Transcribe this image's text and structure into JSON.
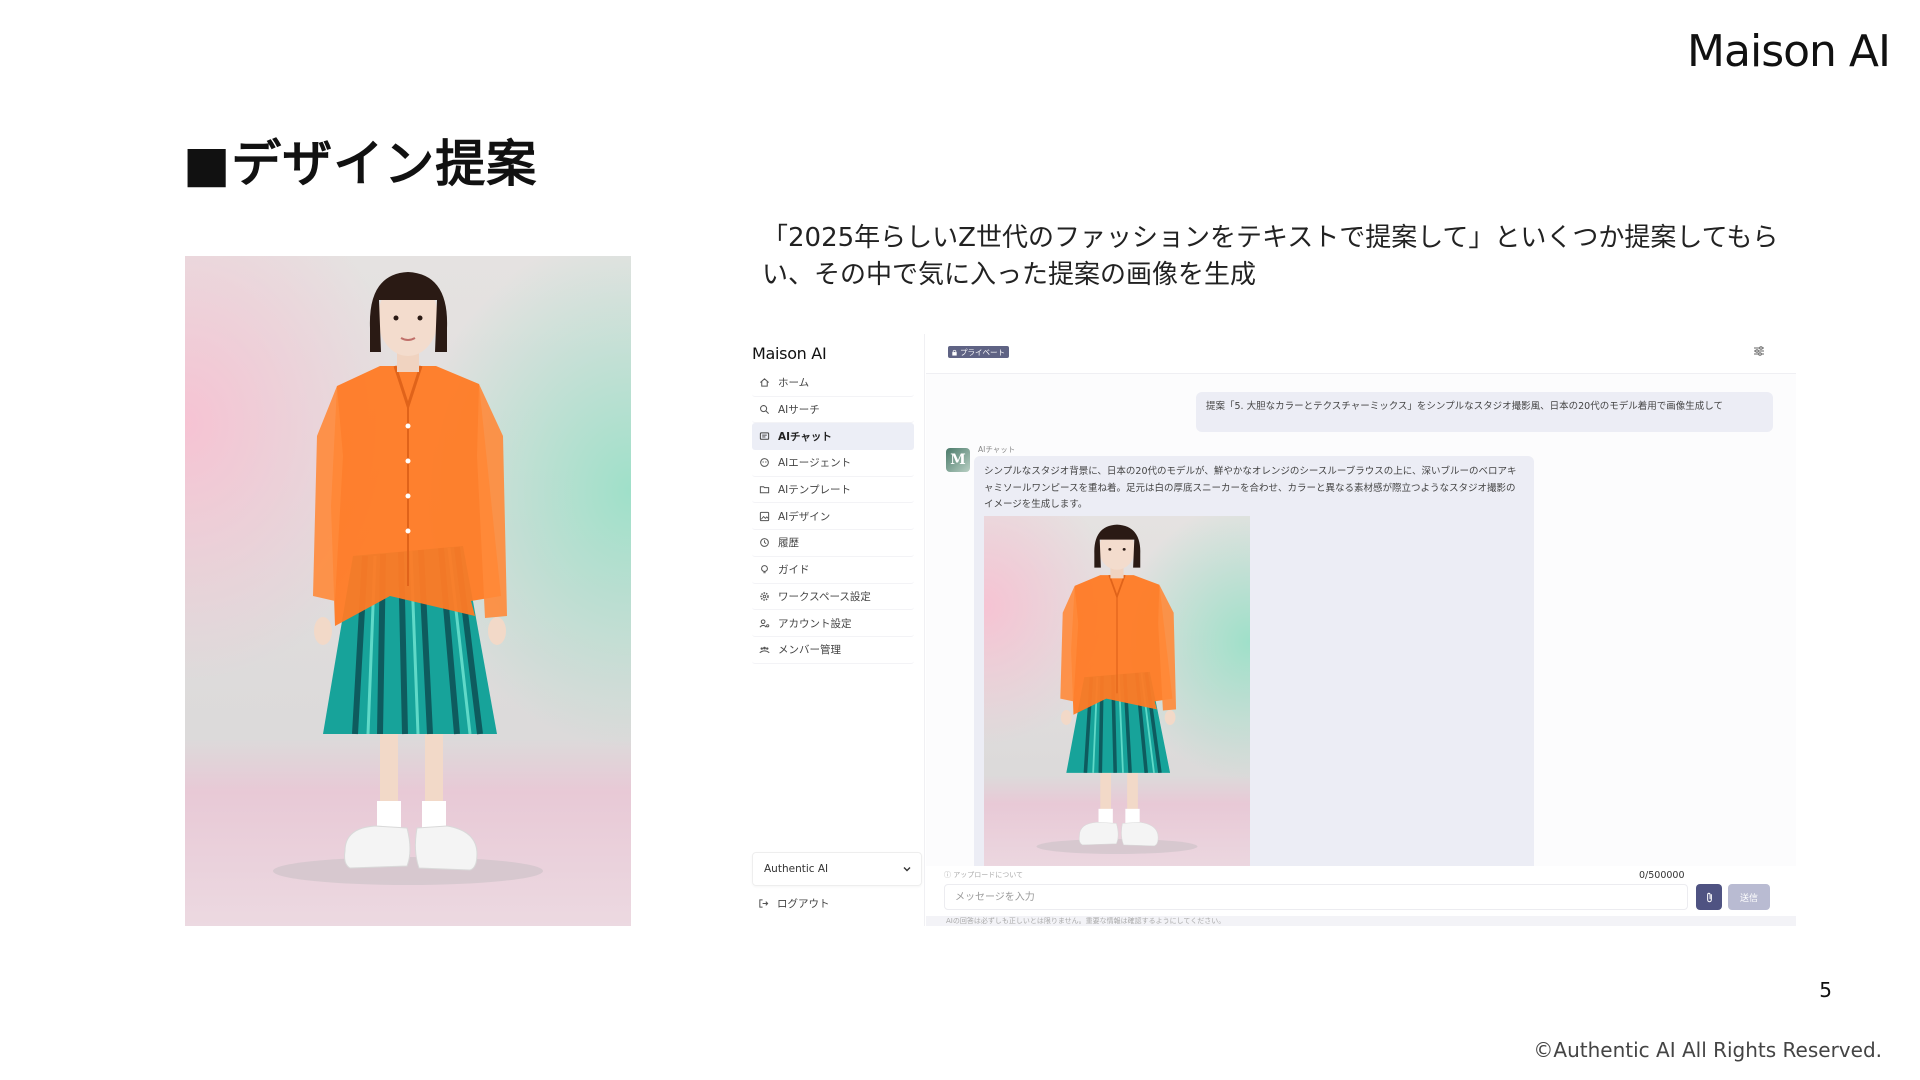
{
  "slide": {
    "brand": "Maison AI",
    "title": "■デザイン提案",
    "description": "「2025年らしいZ世代のファッションをテキストで提案して」といくつか提案してもらい、その中で気に入った提案の画像を生成",
    "page_number": "5",
    "copyright": "©Authentic AI All Rights Reserved."
  },
  "app": {
    "logo": "Maison AI",
    "nav": [
      {
        "label": "ホーム",
        "icon": "home-icon"
      },
      {
        "label": "AIサーチ",
        "icon": "search-icon"
      },
      {
        "label": "AIチャット",
        "icon": "chat-icon",
        "active": true
      },
      {
        "label": "AIエージェント",
        "icon": "agent-icon"
      },
      {
        "label": "AIテンプレート",
        "icon": "folder-icon"
      },
      {
        "label": "AIデザイン",
        "icon": "image-icon"
      },
      {
        "label": "履歴",
        "icon": "history-icon"
      },
      {
        "label": "ガイド",
        "icon": "bulb-icon"
      },
      {
        "label": "ワークスペース設定",
        "icon": "gear-icon"
      },
      {
        "label": "アカウント設定",
        "icon": "user-gear-icon"
      },
      {
        "label": "メンバー管理",
        "icon": "members-icon"
      }
    ],
    "workspace": "Authentic AI",
    "logout": "ログアウト",
    "chat": {
      "private_badge": "プライベート",
      "user_message": "提案「5. 大胆なカラーとテクスチャーミックス」をシンプルなスタジオ撮影風、日本の20代のモデル着用で画像生成して",
      "ai_name": "AIチャット",
      "ai_message": "シンプルなスタジオ背景に、日本の20代のモデルが、鮮やかなオレンジのシースルーブラウスの上に、深いブルーのベロアキャミソールワンピースを重ね着。足元は白の厚底スニーカーを合わせ、カラーと異なる素材感が際立つようなスタジオ撮影のイメージを生成します。",
      "upload_note": "アップロードについて",
      "char_count": "0/500000",
      "input_placeholder": "メッセージを入力",
      "send_label": "送信",
      "disclaimer": "AIの回答は必ずしも正しいとは限りません。重要な情報は確認するようにしてください。"
    }
  },
  "colors": {
    "accent": "#4f5382",
    "bubble": "#ecedf5",
    "blouse": "#ff7a24",
    "skirt": "#17a39a"
  }
}
